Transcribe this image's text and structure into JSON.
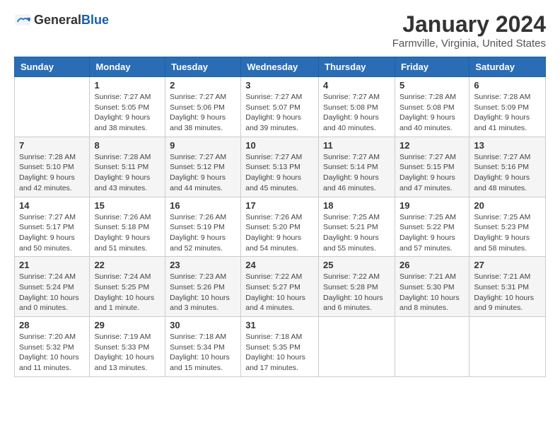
{
  "header": {
    "logo_general": "General",
    "logo_blue": "Blue",
    "month_title": "January 2024",
    "location": "Farmville, Virginia, United States"
  },
  "days_of_week": [
    "Sunday",
    "Monday",
    "Tuesday",
    "Wednesday",
    "Thursday",
    "Friday",
    "Saturday"
  ],
  "weeks": [
    [
      {
        "day": "",
        "empty": true
      },
      {
        "day": "1",
        "sunrise": "7:27 AM",
        "sunset": "5:05 PM",
        "daylight": "9 hours and 38 minutes."
      },
      {
        "day": "2",
        "sunrise": "7:27 AM",
        "sunset": "5:06 PM",
        "daylight": "9 hours and 38 minutes."
      },
      {
        "day": "3",
        "sunrise": "7:27 AM",
        "sunset": "5:07 PM",
        "daylight": "9 hours and 39 minutes."
      },
      {
        "day": "4",
        "sunrise": "7:27 AM",
        "sunset": "5:08 PM",
        "daylight": "9 hours and 40 minutes."
      },
      {
        "day": "5",
        "sunrise": "7:28 AM",
        "sunset": "5:08 PM",
        "daylight": "9 hours and 40 minutes."
      },
      {
        "day": "6",
        "sunrise": "7:28 AM",
        "sunset": "5:09 PM",
        "daylight": "9 hours and 41 minutes."
      }
    ],
    [
      {
        "day": "7",
        "sunrise": "7:28 AM",
        "sunset": "5:10 PM",
        "daylight": "9 hours and 42 minutes."
      },
      {
        "day": "8",
        "sunrise": "7:28 AM",
        "sunset": "5:11 PM",
        "daylight": "9 hours and 43 minutes."
      },
      {
        "day": "9",
        "sunrise": "7:27 AM",
        "sunset": "5:12 PM",
        "daylight": "9 hours and 44 minutes."
      },
      {
        "day": "10",
        "sunrise": "7:27 AM",
        "sunset": "5:13 PM",
        "daylight": "9 hours and 45 minutes."
      },
      {
        "day": "11",
        "sunrise": "7:27 AM",
        "sunset": "5:14 PM",
        "daylight": "9 hours and 46 minutes."
      },
      {
        "day": "12",
        "sunrise": "7:27 AM",
        "sunset": "5:15 PM",
        "daylight": "9 hours and 47 minutes."
      },
      {
        "day": "13",
        "sunrise": "7:27 AM",
        "sunset": "5:16 PM",
        "daylight": "9 hours and 48 minutes."
      }
    ],
    [
      {
        "day": "14",
        "sunrise": "7:27 AM",
        "sunset": "5:17 PM",
        "daylight": "9 hours and 50 minutes."
      },
      {
        "day": "15",
        "sunrise": "7:26 AM",
        "sunset": "5:18 PM",
        "daylight": "9 hours and 51 minutes."
      },
      {
        "day": "16",
        "sunrise": "7:26 AM",
        "sunset": "5:19 PM",
        "daylight": "9 hours and 52 minutes."
      },
      {
        "day": "17",
        "sunrise": "7:26 AM",
        "sunset": "5:20 PM",
        "daylight": "9 hours and 54 minutes."
      },
      {
        "day": "18",
        "sunrise": "7:25 AM",
        "sunset": "5:21 PM",
        "daylight": "9 hours and 55 minutes."
      },
      {
        "day": "19",
        "sunrise": "7:25 AM",
        "sunset": "5:22 PM",
        "daylight": "9 hours and 57 minutes."
      },
      {
        "day": "20",
        "sunrise": "7:25 AM",
        "sunset": "5:23 PM",
        "daylight": "9 hours and 58 minutes."
      }
    ],
    [
      {
        "day": "21",
        "sunrise": "7:24 AM",
        "sunset": "5:24 PM",
        "daylight": "10 hours and 0 minutes."
      },
      {
        "day": "22",
        "sunrise": "7:24 AM",
        "sunset": "5:25 PM",
        "daylight": "10 hours and 1 minute."
      },
      {
        "day": "23",
        "sunrise": "7:23 AM",
        "sunset": "5:26 PM",
        "daylight": "10 hours and 3 minutes."
      },
      {
        "day": "24",
        "sunrise": "7:22 AM",
        "sunset": "5:27 PM",
        "daylight": "10 hours and 4 minutes."
      },
      {
        "day": "25",
        "sunrise": "7:22 AM",
        "sunset": "5:28 PM",
        "daylight": "10 hours and 6 minutes."
      },
      {
        "day": "26",
        "sunrise": "7:21 AM",
        "sunset": "5:30 PM",
        "daylight": "10 hours and 8 minutes."
      },
      {
        "day": "27",
        "sunrise": "7:21 AM",
        "sunset": "5:31 PM",
        "daylight": "10 hours and 9 minutes."
      }
    ],
    [
      {
        "day": "28",
        "sunrise": "7:20 AM",
        "sunset": "5:32 PM",
        "daylight": "10 hours and 11 minutes."
      },
      {
        "day": "29",
        "sunrise": "7:19 AM",
        "sunset": "5:33 PM",
        "daylight": "10 hours and 13 minutes."
      },
      {
        "day": "30",
        "sunrise": "7:18 AM",
        "sunset": "5:34 PM",
        "daylight": "10 hours and 15 minutes."
      },
      {
        "day": "31",
        "sunrise": "7:18 AM",
        "sunset": "5:35 PM",
        "daylight": "10 hours and 17 minutes."
      },
      {
        "day": "",
        "empty": true
      },
      {
        "day": "",
        "empty": true
      },
      {
        "day": "",
        "empty": true
      }
    ]
  ],
  "labels": {
    "sunrise": "Sunrise:",
    "sunset": "Sunset:",
    "daylight": "Daylight:"
  }
}
